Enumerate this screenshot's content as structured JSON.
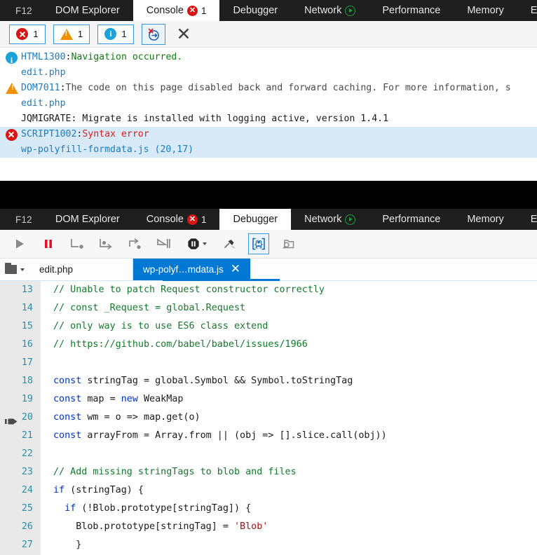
{
  "devtools": {
    "f12_label": "F12",
    "tabs": [
      {
        "label": "DOM Explorer",
        "icon": "",
        "count": ""
      },
      {
        "label": "Console",
        "icon": "error-badge",
        "count": "1"
      },
      {
        "label": "Debugger",
        "icon": "",
        "count": ""
      },
      {
        "label": "Network",
        "icon": "play-badge",
        "count": ""
      },
      {
        "label": "Performance",
        "icon": "",
        "count": ""
      },
      {
        "label": "Memory",
        "icon": "",
        "count": ""
      },
      {
        "label": "E",
        "icon": "",
        "count": ""
      }
    ],
    "console_active_tab": "Console",
    "debugger_active_tab": "Debugger"
  },
  "console": {
    "toolbar": {
      "error_count": "1",
      "warning_count": "1",
      "info_count": "1",
      "error_icon": "error-circle-icon",
      "warning_icon": "warning-triangle-icon",
      "info_icon": "info-circle-icon",
      "clear_on_navigate_icon": "clear-on-navigate-icon",
      "clear_icon": "close-x-icon",
      "clear_label": "✕"
    },
    "messages": [
      {
        "severity": "info",
        "code": "HTML1300",
        "separator": ": ",
        "text": "Navigation occurred.",
        "text_class": "msg-green",
        "source": "edit.php",
        "selected": false
      },
      {
        "severity": "warning",
        "code": "DOM7011",
        "separator": ": ",
        "text": "The code on this page disabled back and forward caching. For more information, s",
        "text_class": "msg-gray",
        "source": "edit.php",
        "selected": false
      },
      {
        "severity": "none",
        "code": "",
        "separator": "",
        "text": "JQMIGRATE: Migrate is installed with logging active, version 1.4.1",
        "text_class": "msg-black",
        "source": "",
        "selected": false
      },
      {
        "severity": "error",
        "code": "SCRIPT1002",
        "separator": ": ",
        "text": "Syntax error",
        "text_class": "msg-red",
        "source": "wp-polyfill-formdata.js (20,17)",
        "selected": true
      }
    ]
  },
  "debugger": {
    "toolbar_buttons": [
      {
        "name": "continue-button",
        "icon": "play-icon",
        "title": "Continue"
      },
      {
        "name": "break-button",
        "icon": "pause-icon",
        "title": "Break"
      },
      {
        "name": "step-into-button",
        "icon": "step-into-icon",
        "title": "Step into"
      },
      {
        "name": "step-over-button",
        "icon": "step-over-icon",
        "title": "Step over"
      },
      {
        "name": "step-out-button",
        "icon": "step-out-icon",
        "title": "Step out"
      },
      {
        "name": "run-to-cursor-button",
        "icon": "run-to-cursor-icon",
        "title": "Run to cursor"
      },
      {
        "name": "break-on-button",
        "icon": "break-on-octagon-icon",
        "title": "Break on"
      },
      {
        "name": "break-on-new-worker-button",
        "icon": "pin-icon",
        "title": "Break on new worker"
      },
      {
        "name": "pretty-print-button",
        "icon": "pretty-print-icon",
        "title": "Pretty print",
        "active": true
      },
      {
        "name": "find-in-files-button",
        "icon": "search-folder-icon",
        "title": "Find in files"
      }
    ],
    "file_picker_icon": "folder-icon",
    "file_picker_caret": "chevron-down-icon",
    "file_tabs": [
      {
        "label": "edit.php",
        "active": false,
        "closable": false
      },
      {
        "label": "wp-polyf…mdata.js",
        "active": true,
        "closable": true,
        "close_label": "✕"
      }
    ],
    "code": {
      "current_execution_line": 20,
      "lines": [
        {
          "n": "13",
          "tokens": [
            {
              "t": "// Unable to patch Request constructor correctly",
              "c": "cm"
            }
          ]
        },
        {
          "n": "14",
          "tokens": [
            {
              "t": "// const _Request = global.Request",
              "c": "cm"
            }
          ]
        },
        {
          "n": "15",
          "tokens": [
            {
              "t": "// only way is to use ES6 class extend",
              "c": "cm"
            }
          ]
        },
        {
          "n": "16",
          "tokens": [
            {
              "t": "// https://github.com/babel/babel/issues/1966",
              "c": "cm"
            }
          ]
        },
        {
          "n": "17",
          "tokens": [
            {
              "t": "",
              "c": "pl"
            }
          ]
        },
        {
          "n": "18",
          "tokens": [
            {
              "t": "const",
              "c": "k"
            },
            {
              "t": " stringTag = global.Symbol && Symbol.toStringTag",
              "c": "pl"
            }
          ]
        },
        {
          "n": "19",
          "tokens": [
            {
              "t": "const",
              "c": "k"
            },
            {
              "t": " map = ",
              "c": "pl"
            },
            {
              "t": "new",
              "c": "k"
            },
            {
              "t": " WeakMap",
              "c": "pl"
            }
          ]
        },
        {
          "n": "20",
          "tokens": [
            {
              "t": "const",
              "c": "k"
            },
            {
              "t": " wm = o => map.get(o)",
              "c": "pl"
            }
          ]
        },
        {
          "n": "21",
          "tokens": [
            {
              "t": "const",
              "c": "k"
            },
            {
              "t": " arrayFrom = Array.from || (obj => [].slice.call(obj))",
              "c": "pl"
            }
          ]
        },
        {
          "n": "22",
          "tokens": [
            {
              "t": "",
              "c": "pl"
            }
          ]
        },
        {
          "n": "23",
          "tokens": [
            {
              "t": "// Add missing stringTags to blob and files",
              "c": "cm"
            }
          ]
        },
        {
          "n": "24",
          "tokens": [
            {
              "t": "if",
              "c": "k"
            },
            {
              "t": " (stringTag) {",
              "c": "pl"
            }
          ]
        },
        {
          "n": "25",
          "tokens": [
            {
              "t": "  ",
              "c": "pl"
            },
            {
              "t": "if",
              "c": "k"
            },
            {
              "t": " (!Blob.prototype[stringTag]) {",
              "c": "pl"
            }
          ]
        },
        {
          "n": "26",
          "tokens": [
            {
              "t": "    Blob.prototype[stringTag] = ",
              "c": "pl"
            },
            {
              "t": "'Blob'",
              "c": "st"
            }
          ]
        },
        {
          "n": "27",
          "tokens": [
            {
              "t": "    }",
              "c": "pl"
            }
          ]
        }
      ]
    }
  },
  "colors": {
    "tabstrip_bg": "#1e1e1e",
    "accent_blue": "#0078d4",
    "selection_blue": "#d8e9f7",
    "error_red": "#d91414",
    "warning_orange": "#f09000",
    "info_blue": "#19a3d8",
    "comment_green": "#137a2b",
    "keyword_blue": "#0033cc",
    "string_red": "#a31515",
    "linenum_teal": "#2b8fa8",
    "gutter_gray": "#e9e9e9"
  }
}
